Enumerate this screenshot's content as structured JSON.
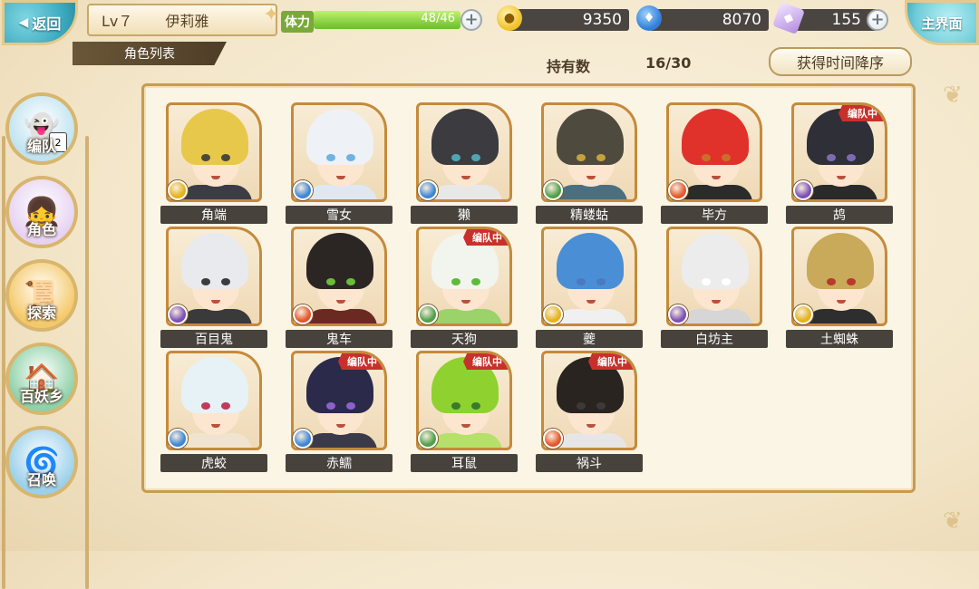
{
  "header": {
    "back_label": "返回",
    "level": "Lv７",
    "player_name": "伊莉雅",
    "stamina_label": "体力",
    "stamina_text": "48/46",
    "stamina_fraction": 1.0,
    "gold": "9350",
    "soul": "8070",
    "crystal": "155",
    "main_label": "主界面"
  },
  "subheader": {
    "list_title": "角色列表",
    "hold_label": "持有数",
    "hold_count": "16/30",
    "sort_label": "获得时间降序"
  },
  "sidebar": [
    {
      "label": "编队",
      "badge": "2"
    },
    {
      "label": "角色"
    },
    {
      "label": "探索"
    },
    {
      "label": "百妖乡"
    },
    {
      "label": "召唤"
    }
  ],
  "team_badge_text": "编队中",
  "characters": [
    {
      "name": "角端",
      "hair": "#e8c84a",
      "eye": "#4a4a3a",
      "cloth": "#3c3c46",
      "attr": "#e6b21c",
      "team": false
    },
    {
      "name": "雪女",
      "hair": "#eef1f5",
      "eye": "#6fb3e0",
      "cloth": "#dfe8f2",
      "attr": "#3f86d6",
      "team": false
    },
    {
      "name": "獭",
      "hair": "#3b3b40",
      "eye": "#4fa6b0",
      "cloth": "#e8e8e8",
      "attr": "#3f86d6",
      "team": false
    },
    {
      "name": "精蝼蛄",
      "hair": "#4f4a3e",
      "eye": "#c4a33a",
      "cloth": "#4a6f80",
      "attr": "#4fa04a",
      "team": false
    },
    {
      "name": "毕方",
      "hair": "#e0322a",
      "eye": "#c96f2a",
      "cloth": "#2b2b2b",
      "attr": "#e4572a",
      "team": false
    },
    {
      "name": "鸪",
      "hair": "#2f2f38",
      "eye": "#7d6bb0",
      "cloth": "#2a2a2a",
      "attr": "#7c4fb5",
      "team": true
    },
    {
      "name": "百目鬼",
      "hair": "#e8eaee",
      "eye": "#3c3c3c",
      "cloth": "#3a3a3a",
      "attr": "#7c4fb5",
      "team": false
    },
    {
      "name": "鬼车",
      "hair": "#2b2624",
      "eye": "#6dbb3a",
      "cloth": "#6a2a22",
      "attr": "#e4572a",
      "team": false
    },
    {
      "name": "天狗",
      "hair": "#f2f4ee",
      "eye": "#5dbb3a",
      "cloth": "#9cd26a",
      "attr": "#4fa04a",
      "team": true
    },
    {
      "name": "夔",
      "hair": "#4a8ed6",
      "eye": "#4a7abf",
      "cloth": "#f0f0f0",
      "attr": "#e6b21c",
      "team": false
    },
    {
      "name": "白坊主",
      "hair": "#ececec",
      "eye": "#ffffff",
      "cloth": "#d6d6d6",
      "attr": "#7c4fb5",
      "team": false
    },
    {
      "name": "土蜘蛛",
      "hair": "#c9a95a",
      "eye": "#b83a2a",
      "cloth": "#2e2e2e",
      "attr": "#e6b21c",
      "team": false
    },
    {
      "name": "虎蛟",
      "hair": "#e6f2f6",
      "eye": "#c23a5a",
      "cloth": "#f0e4d0",
      "attr": "#3f86d6",
      "team": false
    },
    {
      "name": "赤鱬",
      "hair": "#2b2a4a",
      "eye": "#8b62c8",
      "cloth": "#3a3a4a",
      "attr": "#3f86d6",
      "team": true
    },
    {
      "name": "耳鼠",
      "hair": "#8fd12e",
      "eye": "#3a7a2a",
      "cloth": "#b5e06a",
      "attr": "#4fa04a",
      "team": true
    },
    {
      "name": "祸斗",
      "hair": "#2a2420",
      "eye": "#3a3a3a",
      "cloth": "#e6e6e6",
      "attr": "#e4572a",
      "team": true
    }
  ],
  "colors": {
    "gold_icon": "#f0c22a",
    "soul_icon": "#2f7fd8",
    "crystal_icon": "#b38be0",
    "sidebar_bg": [
      "#bfe3f0",
      "#e7d2f2",
      "#f5c96a",
      "#8fd1a8",
      "#9ad0ea"
    ]
  }
}
